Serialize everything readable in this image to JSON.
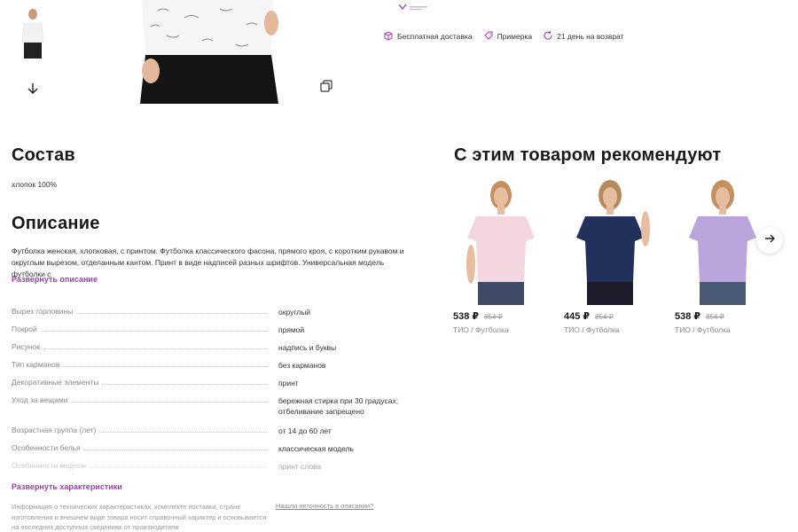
{
  "perks": [
    {
      "icon": "box-icon",
      "label": "Бесплатная доставка"
    },
    {
      "icon": "tag-icon",
      "label": "Примерка"
    },
    {
      "icon": "refresh-icon",
      "label": "21 день на возврат"
    }
  ],
  "composition": {
    "title": "Состав",
    "value": "хлопок 100%"
  },
  "description": {
    "title": "Описание",
    "text": "Футболка женская, хлопковая, с принтом. Футболка классического фасона, прямого кроя, с коротким рукавом и округлым вырезом, отделанным кантом. Принт в виде надписей разных шрифтов. Универсальная модель футболки с",
    "expand_label": "Развернуть описание"
  },
  "specs": {
    "rows": [
      {
        "key": "Вырез горловины",
        "value": "округлый"
      },
      {
        "key": "Покрой",
        "value": "прямой"
      },
      {
        "key": "Рисунок",
        "value": "надпись и буквы"
      },
      {
        "key": "Тип карманов",
        "value": "без карманов"
      },
      {
        "key": "Декоративные элементы",
        "value": "принт"
      },
      {
        "key": "Уход за вещами",
        "value": "бережная стирка при 30 градусах; отбеливание запрещено"
      },
      {
        "key": "Возрастная группа (лет)",
        "value": "от 14 до 60 лет"
      },
      {
        "key": "Особенности белья",
        "value": "классическая модель"
      },
      {
        "key": "Особенности модели",
        "value": "принт слова"
      }
    ],
    "expand_label": "Развернуть характеристики"
  },
  "disclaimer": "Информация о технических характеристиках, комплекте поставки, стране изготовления и внешнем виде товара носит справочный характер и основывается на последних доступных сведениях от производителя",
  "report_link": "Нашли неточность в описании?",
  "recommendations": {
    "title": "С этим товаром рекомендуют",
    "items": [
      {
        "price": "538 ₽",
        "old_price": "854 ₽",
        "name": "ТИО / Футболка",
        "shirt_color": "#f4d6df"
      },
      {
        "price": "445 ₽",
        "old_price": "854 ₽",
        "name": "ТИО / Футболка",
        "shirt_color": "#23305c"
      },
      {
        "price": "538 ₽",
        "old_price": "854 ₽",
        "name": "ТИО / Футболка",
        "shirt_color": "#b9a5dc"
      }
    ]
  },
  "colors": {
    "accent": "#a13ab5"
  }
}
